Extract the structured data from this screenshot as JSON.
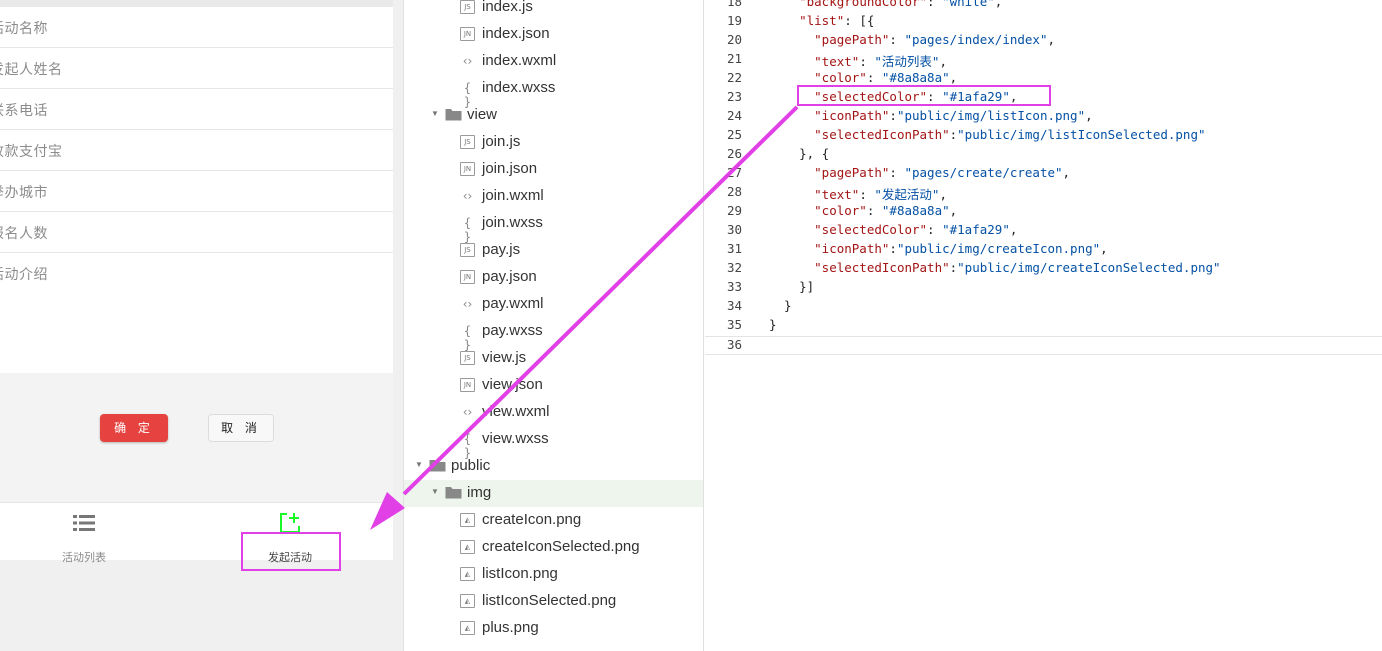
{
  "simulator": {
    "form_fields": [
      "活动名称",
      "发起人姓名",
      "联系电话",
      "收款支付宝",
      "举办城市",
      "报名人数",
      "活动介绍"
    ],
    "confirm_label": "确 定",
    "cancel_label": "取 消",
    "tabbar": [
      {
        "label": "活动列表",
        "icon": "list-icon",
        "color": "#8a8a8a"
      },
      {
        "label": "发起活动",
        "icon": "create-plus-icon",
        "color": "#1afa29"
      }
    ]
  },
  "file_tree": [
    {
      "name": "index.js",
      "type": "js",
      "depth": 2
    },
    {
      "name": "index.json",
      "type": "json",
      "depth": 2
    },
    {
      "name": "index.wxml",
      "type": "wxml",
      "depth": 2
    },
    {
      "name": "index.wxss",
      "type": "wxss",
      "depth": 2
    },
    {
      "name": "view",
      "type": "folder",
      "depth": 1,
      "expanded": true
    },
    {
      "name": "join.js",
      "type": "js",
      "depth": 2
    },
    {
      "name": "join.json",
      "type": "json",
      "depth": 2
    },
    {
      "name": "join.wxml",
      "type": "wxml",
      "depth": 2
    },
    {
      "name": "join.wxss",
      "type": "wxss",
      "depth": 2
    },
    {
      "name": "pay.js",
      "type": "js",
      "depth": 2
    },
    {
      "name": "pay.json",
      "type": "json",
      "depth": 2
    },
    {
      "name": "pay.wxml",
      "type": "wxml",
      "depth": 2
    },
    {
      "name": "pay.wxss",
      "type": "wxss",
      "depth": 2
    },
    {
      "name": "view.js",
      "type": "js",
      "depth": 2
    },
    {
      "name": "view.json",
      "type": "json",
      "depth": 2
    },
    {
      "name": "view.wxml",
      "type": "wxml",
      "depth": 2
    },
    {
      "name": "view.wxss",
      "type": "wxss",
      "depth": 2
    },
    {
      "name": "public",
      "type": "folder",
      "depth": 0,
      "expanded": true
    },
    {
      "name": "img",
      "type": "folder",
      "depth": 1,
      "expanded": true,
      "selected": true
    },
    {
      "name": "createIcon.png",
      "type": "image",
      "depth": 2
    },
    {
      "name": "createIconSelected.png",
      "type": "image",
      "depth": 2
    },
    {
      "name": "listIcon.png",
      "type": "image",
      "depth": 2
    },
    {
      "name": "listIconSelected.png",
      "type": "image",
      "depth": 2
    },
    {
      "name": "plus.png",
      "type": "image",
      "depth": 2
    }
  ],
  "editor": {
    "lines": [
      {
        "n": "18",
        "code": "    \"backgroundColor\": \"white\","
      },
      {
        "n": "19",
        "code": "    \"list\": [{"
      },
      {
        "n": "20",
        "code": "      \"pagePath\": \"pages/index/index\","
      },
      {
        "n": "21",
        "code": "      \"text\": \"活动列表\","
      },
      {
        "n": "22",
        "code": "      \"color\": \"#8a8a8a\","
      },
      {
        "n": "23",
        "code": "      \"selectedColor\": \"#1afa29\","
      },
      {
        "n": "24",
        "code": "      \"iconPath\":\"public/img/listIcon.png\","
      },
      {
        "n": "25",
        "code": "      \"selectedIconPath\":\"public/img/listIconSelected.png\""
      },
      {
        "n": "26",
        "code": "    }, {"
      },
      {
        "n": "27",
        "code": "      \"pagePath\": \"pages/create/create\","
      },
      {
        "n": "28",
        "code": "      \"text\": \"发起活动\","
      },
      {
        "n": "29",
        "code": "      \"color\": \"#8a8a8a\","
      },
      {
        "n": "30",
        "code": "      \"selectedColor\": \"#1afa29\","
      },
      {
        "n": "31",
        "code": "      \"iconPath\":\"public/img/createIcon.png\","
      },
      {
        "n": "32",
        "code": "      \"selectedIconPath\":\"public/img/createIconSelected.png\""
      },
      {
        "n": "33",
        "code": "    }]"
      },
      {
        "n": "34",
        "code": "  }"
      },
      {
        "n": "35",
        "code": "}"
      },
      {
        "n": "36",
        "code": ""
      }
    ],
    "highlighted_line": "23",
    "current_line": "36"
  },
  "colors": {
    "annotation": "#e040e6",
    "selected_tab": "#1afa29",
    "confirm_button": "#e64340"
  }
}
